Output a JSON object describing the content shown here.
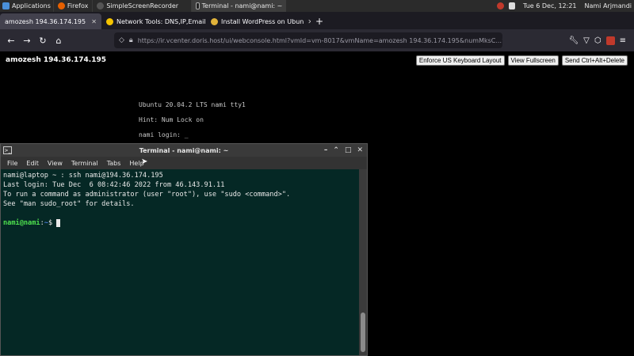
{
  "panel": {
    "applications": "Applications",
    "tasks": [
      {
        "label": "Firefox",
        "color": "#e66000",
        "active": false
      },
      {
        "label": "SimpleScreenRecorder",
        "color": "#444",
        "active": false
      },
      {
        "label": "Terminal - nami@nami: ~",
        "color": "#333",
        "active": true
      }
    ],
    "datetime": "Tue 6 Dec, 12:21",
    "user": "Nami Arjmandi"
  },
  "browser": {
    "tabs": [
      {
        "label": "amozesh 194.36.174.195",
        "active": true
      },
      {
        "label": "Network Tools: DNS,IP,Email",
        "active": false
      },
      {
        "label": "Install WordPress on Ubun",
        "active": false
      }
    ],
    "url": "https://ir.vcenter.doris.host/ui/webconsole.html?vmId=vm-8017&vmName=amozesh 194.36.174.195&numMksC..."
  },
  "console": {
    "vm_title": "amozesh 194.36.174.195",
    "buttons": {
      "keyboard": "Enforce US Keyboard Layout",
      "fullscreen": "View Fullscreen",
      "cad": "Send Ctrl+Alt+Delete"
    },
    "screen_lines": [
      "Ubuntu 20.04.2 LTS nami tty1",
      "Hint: Num Lock on",
      "nami login: _"
    ]
  },
  "terminal": {
    "title": "Terminal - nami@nami: ~",
    "menu": [
      "File",
      "Edit",
      "View",
      "Terminal",
      "Tabs",
      "Help"
    ],
    "lines": [
      "nami@laptop ~ : ssh nami@194.36.174.195",
      "Last login: Tue Dec  6 08:42:46 2022 from 46.143.91.11",
      "To run a command as administrator (user \"root\"), use \"sudo <command>\".",
      "See \"man sudo_root\" for details.",
      ""
    ],
    "prompt_user": "nami@nami",
    "prompt_sep": ":",
    "prompt_path": "~",
    "prompt_symbol": "$"
  }
}
